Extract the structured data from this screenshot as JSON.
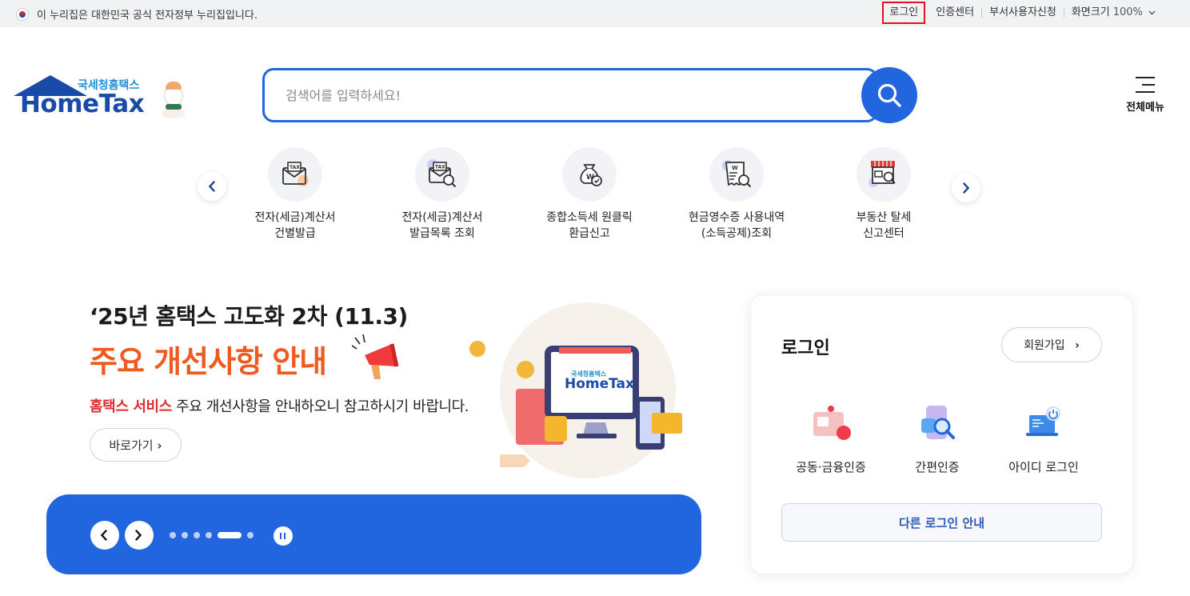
{
  "topbar": {
    "gov_notice": "이 누리집은 대한민국 공식 전자정부 누리집입니다.",
    "links": {
      "login": "로그인",
      "cert_center": "인증센터",
      "dept_user_apply": "부서사용자신청",
      "screen_size": "화면크기",
      "zoom_value": "100%"
    }
  },
  "logo": {
    "subtitle": "국세청홈택스",
    "wordmark": "HomeTax"
  },
  "search": {
    "placeholder": "검색어를 입력하세요!"
  },
  "all_menu": {
    "label": "전체메뉴"
  },
  "quick_menu": [
    {
      "line1": "전자(세금)계산서",
      "line2": "건별발급",
      "icon": "tax-envelope-icon"
    },
    {
      "line1": "전자(세금)계산서",
      "line2": "발급목록 조회",
      "icon": "tax-search-icon"
    },
    {
      "line1": "종합소득세 원클릭",
      "line2": "환급신고",
      "icon": "money-bag-icon"
    },
    {
      "line1": "현금영수증 사용내역",
      "line2": "(소득공제)조회",
      "icon": "receipt-search-icon"
    },
    {
      "line1": "부동산 탈세",
      "line2": "신고센터",
      "icon": "store-search-icon"
    }
  ],
  "banner": {
    "title": "‘25년 홈택스 고도화 2차 (11.3)",
    "headline": "주요 개선사항 안내",
    "desc_highlight": "홈택스 서비스",
    "desc_rest": " 주요 개선사항을 안내하오니 참고하시기 바랍니다.",
    "go_button": "바로가기",
    "illustration_logo_sub": "국세청홈택스",
    "illustration_logo": "HomeTax",
    "slide_count": 6,
    "active_slide": 5
  },
  "login_panel": {
    "title": "로그인",
    "join_button": "회원가입",
    "options": [
      {
        "label": "공동·금융인증",
        "icon": "certificate-card-icon"
      },
      {
        "label": "간편인증",
        "icon": "simple-auth-icon"
      },
      {
        "label": "아이디 로그인",
        "icon": "laptop-power-icon"
      }
    ],
    "other_login": "다른 로그인 안내"
  },
  "colors": {
    "primary_blue": "#2266df",
    "orange": "#f05a1e",
    "red_highlight": "#e0121f"
  }
}
